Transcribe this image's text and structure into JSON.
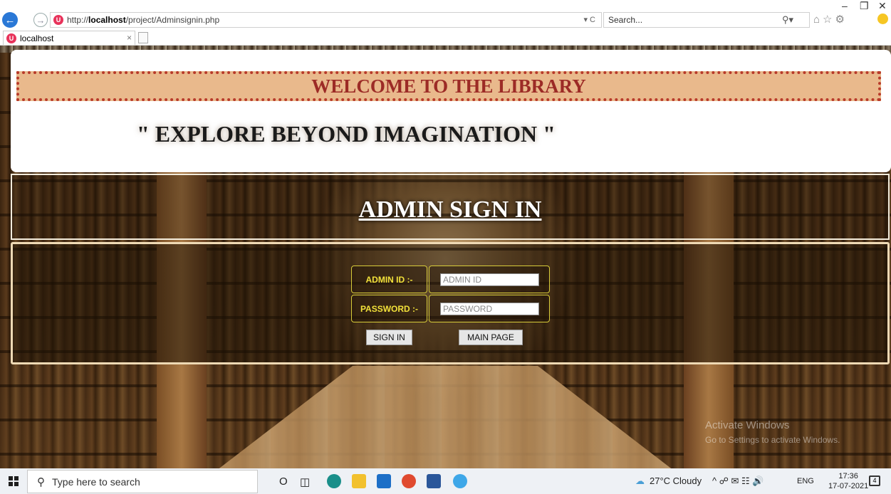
{
  "browser": {
    "url_prefix": "http://",
    "url_host": "localhost",
    "url_path": "/project/Adminsignin.php",
    "url_controls": "▾ C",
    "search_placeholder": "Search...",
    "tab_title": "localhost",
    "tab_close": "×"
  },
  "page": {
    "welcome_text": "WELCOME TO THE LIBRARY",
    "tagline": "\" EXPLORE BEYOND IMAGINATION \"",
    "signin_title": "ADMIN SIGN IN",
    "admin_id_label": "ADMIN ID :-",
    "admin_id_placeholder": "ADMIN ID",
    "password_label": "PASSWORD :-",
    "password_placeholder": "PASSWORD",
    "signin_button": "SIGN IN",
    "main_page_button": "MAIN PAGE"
  },
  "watermark": {
    "title": "Activate Windows",
    "subtitle": "Go to Settings to activate Windows."
  },
  "taskbar": {
    "search_placeholder": "Type here to search",
    "weather": "27°C  Cloudy",
    "language": "ENG",
    "time": "17:36",
    "date": "17-07-2021",
    "notifications": "4"
  },
  "colors": {
    "welcome_bg": "#e9b98c",
    "welcome_text": "#9c2b26",
    "label_text": "#f2e13a",
    "form_border": "#eed9b4"
  }
}
